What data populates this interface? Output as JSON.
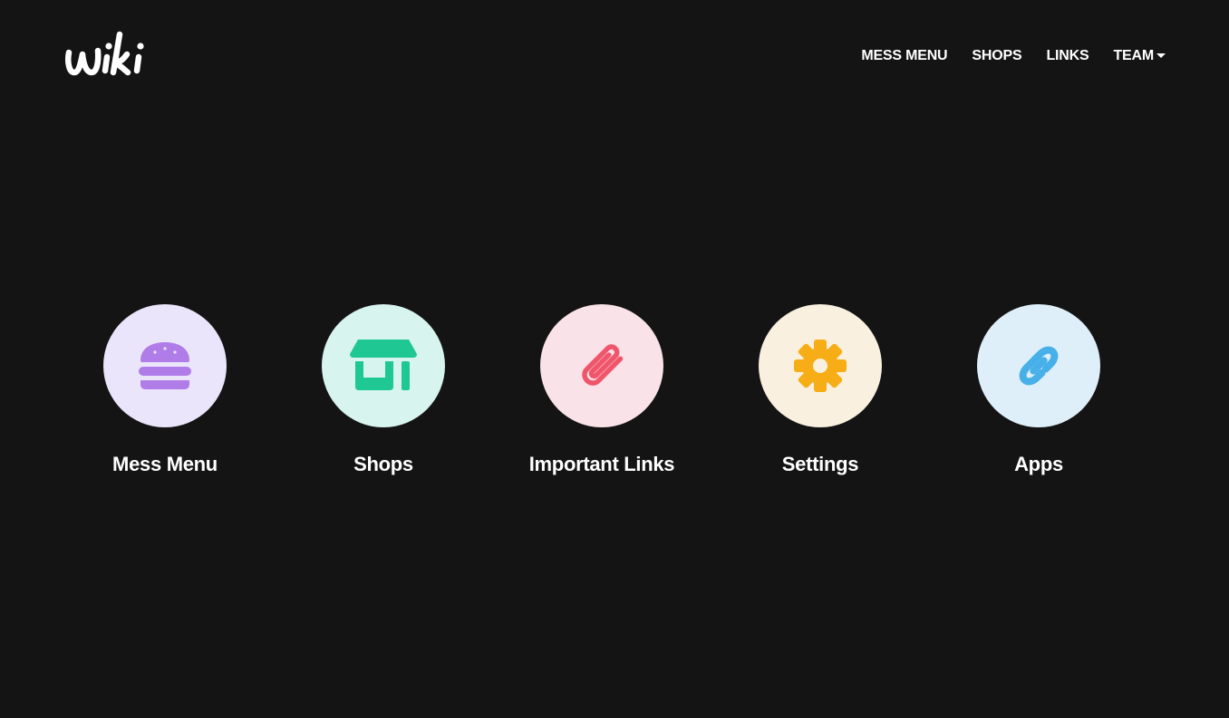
{
  "header": {
    "logo_text": "wiki",
    "nav": [
      {
        "label": "MESS MENU",
        "dropdown": false
      },
      {
        "label": "SHOPS",
        "dropdown": false
      },
      {
        "label": "LINKS",
        "dropdown": false
      },
      {
        "label": "TEAM",
        "dropdown": true
      }
    ]
  },
  "tiles": [
    {
      "label": "Mess Menu",
      "icon": "burger-icon",
      "icon_color": "#b07ce8",
      "bg_color": "#ebe5fb"
    },
    {
      "label": "Shops",
      "icon": "store-icon",
      "icon_color": "#1fc893",
      "bg_color": "#d8f4ee"
    },
    {
      "label": "Important Links",
      "icon": "paperclip-icon",
      "icon_color": "#f0566b",
      "bg_color": "#f9e3e8"
    },
    {
      "label": "Settings",
      "icon": "gear-icon",
      "icon_color": "#f7ae16",
      "bg_color": "#f9f0df"
    },
    {
      "label": "Apps",
      "icon": "link-icon",
      "icon_color": "#48b0e8",
      "bg_color": "#dfeff9"
    }
  ],
  "colors": {
    "background": "#141414",
    "text": "#ffffff"
  }
}
